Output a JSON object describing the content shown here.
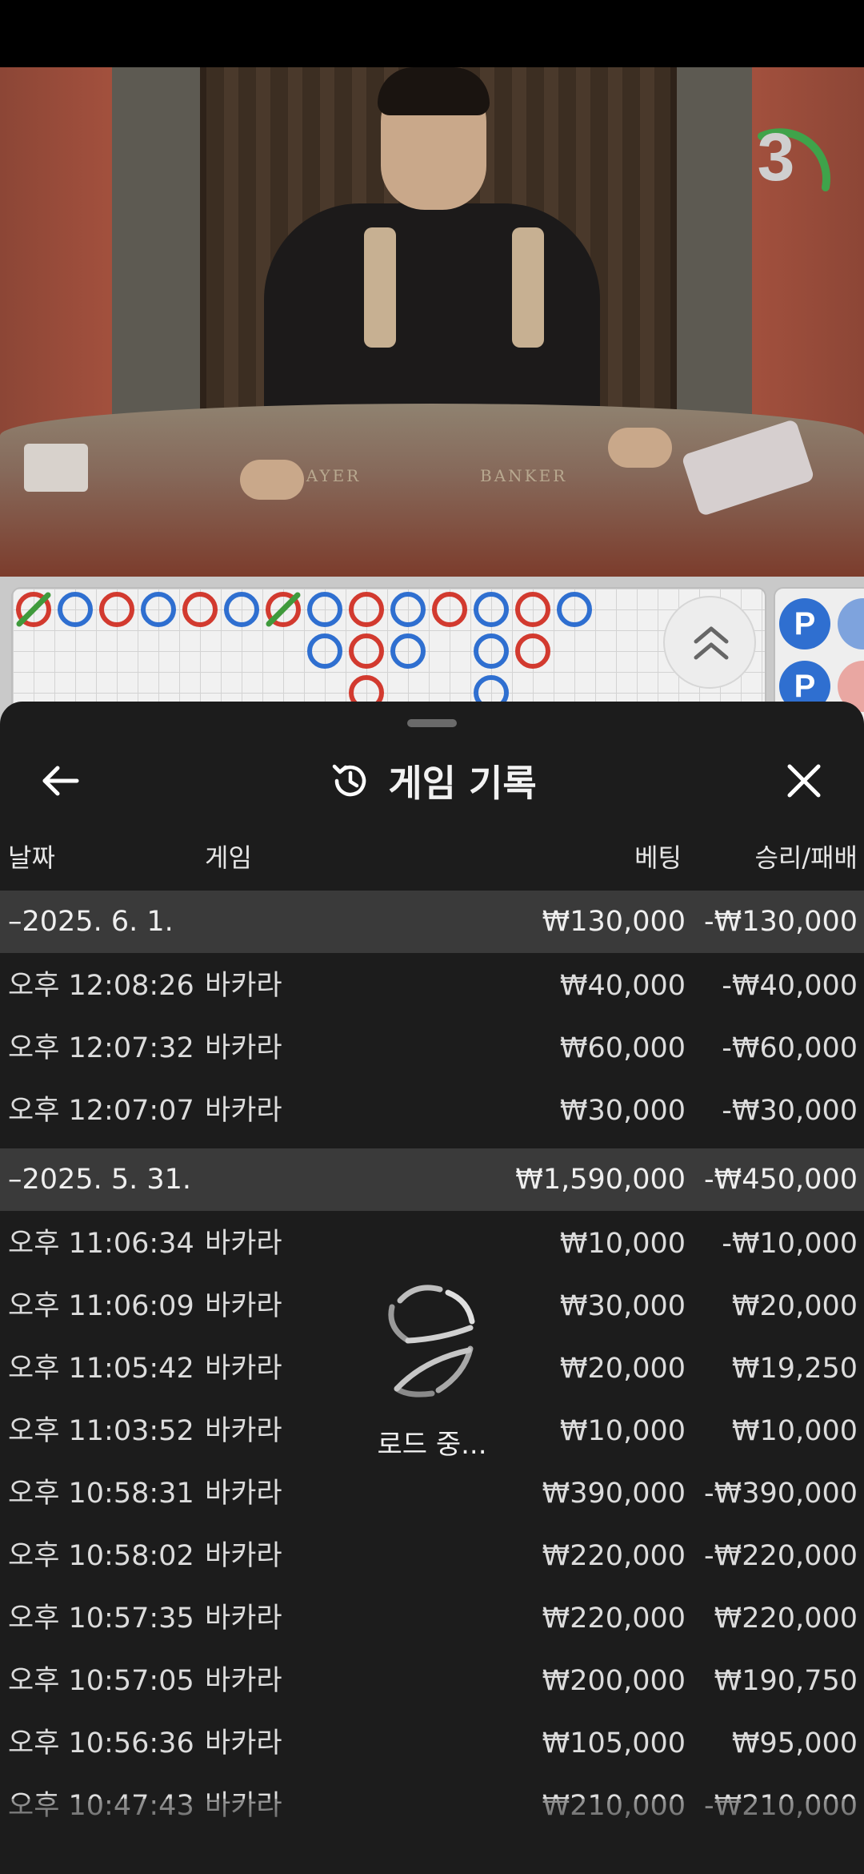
{
  "video": {
    "countdown": "3",
    "table_labels": [
      "PLAYER",
      "BANKER"
    ]
  },
  "roadmap": {
    "bead_labels": [
      "P",
      "P"
    ]
  },
  "sheet": {
    "title": "게임 기록",
    "columns": {
      "date": "날짜",
      "game": "게임",
      "bet": "베팅",
      "result": "승리/패배"
    },
    "groups": [
      {
        "date": "–2025. 6. 1.",
        "bet": "₩130,000",
        "result": "-₩130,000",
        "rows": [
          {
            "time": "오후 12:08:26",
            "game": "바카라",
            "bet": "₩40,000",
            "result": "-₩40,000"
          },
          {
            "time": "오후 12:07:32",
            "game": "바카라",
            "bet": "₩60,000",
            "result": "-₩60,000"
          },
          {
            "time": "오후 12:07:07",
            "game": "바카라",
            "bet": "₩30,000",
            "result": "-₩30,000"
          }
        ]
      },
      {
        "date": "–2025. 5. 31.",
        "bet": "₩1,590,000",
        "result": "-₩450,000",
        "rows": [
          {
            "time": "오후 11:06:34",
            "game": "바카라",
            "bet": "₩10,000",
            "result": "-₩10,000"
          },
          {
            "time": "오후 11:06:09",
            "game": "바카라",
            "bet": "₩30,000",
            "result": "₩20,000"
          },
          {
            "time": "오후 11:05:42",
            "game": "바카라",
            "bet": "₩20,000",
            "result": "₩19,250"
          },
          {
            "time": "오후 11:03:52",
            "game": "바카라",
            "bet": "₩10,000",
            "result": "₩10,000"
          },
          {
            "time": "오후 10:58:31",
            "game": "바카라",
            "bet": "₩390,000",
            "result": "-₩390,000"
          },
          {
            "time": "오후 10:58:02",
            "game": "바카라",
            "bet": "₩220,000",
            "result": "-₩220,000"
          },
          {
            "time": "오후 10:57:35",
            "game": "바카라",
            "bet": "₩220,000",
            "result": "₩220,000"
          },
          {
            "time": "오후 10:57:05",
            "game": "바카라",
            "bet": "₩200,000",
            "result": "₩190,750"
          },
          {
            "time": "오후 10:56:36",
            "game": "바카라",
            "bet": "₩105,000",
            "result": "₩95,000"
          },
          {
            "time": "오후 10:47:43",
            "game": "바카라",
            "bet": "₩210,000",
            "result": "-₩210,000"
          }
        ]
      }
    ],
    "loading_text": "로드 중..."
  },
  "colors": {
    "player_blue": "#2f6fd0",
    "banker_red": "#d23a2f",
    "tie_green": "#3f9a3c",
    "sheet_bg": "#1c1c1c",
    "group_row_bg": "#3a3a3a",
    "timer_arc": "#3fa34a"
  }
}
